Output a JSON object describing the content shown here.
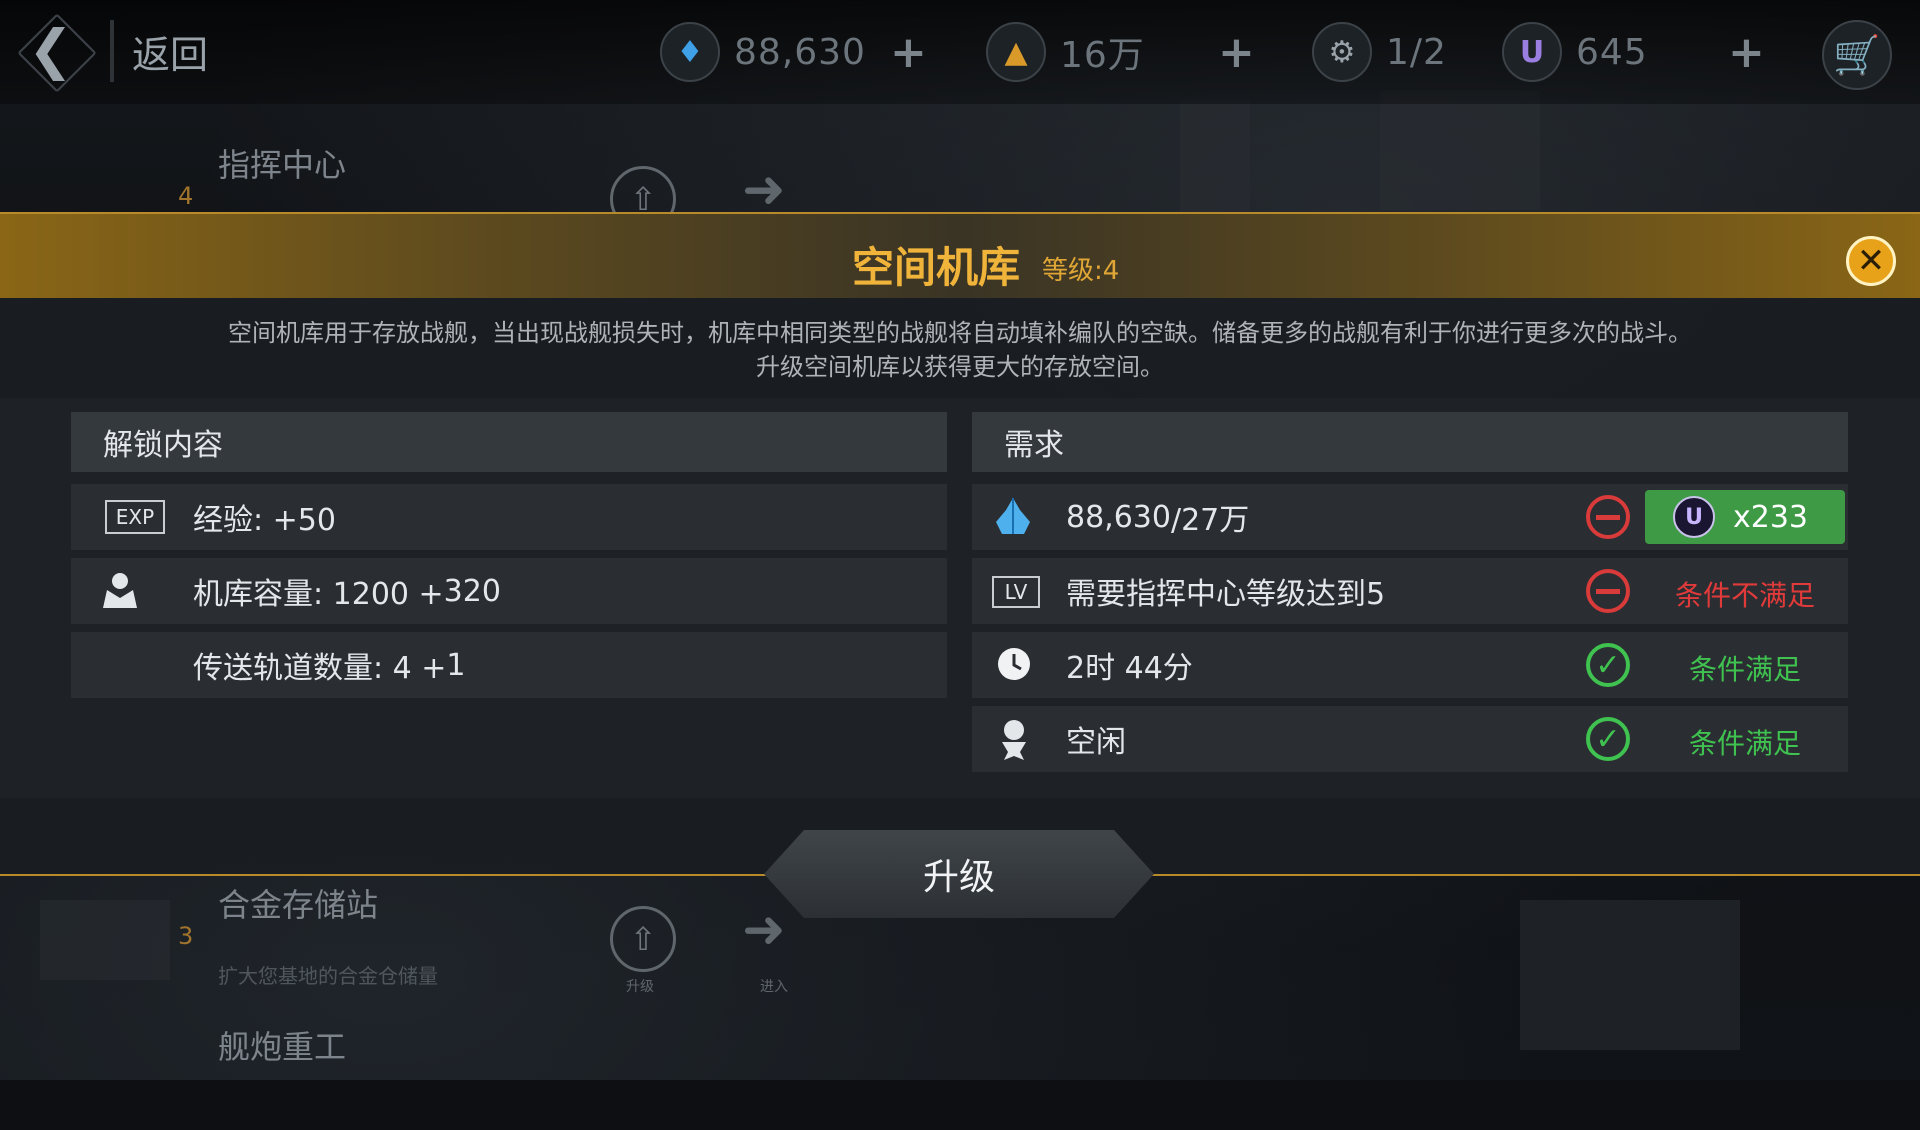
{
  "topbar": {
    "back_label": "返回",
    "resources": [
      {
        "icon": "crystal-icon",
        "value": "88,630"
      },
      {
        "icon": "alloy-icon",
        "value": "16万"
      },
      {
        "icon": "drone-icon",
        "value": "1/2"
      },
      {
        "icon": "u-currency-icon",
        "value": "645"
      }
    ]
  },
  "background_list": [
    {
      "title": "指挥中心",
      "level": "4",
      "subtitle": "",
      "upgrade_caption": "",
      "enter_caption": ""
    },
    {
      "title": "合金存储站",
      "level": "3",
      "subtitle": "扩大您基地的合金仓储量",
      "upgrade_caption": "升级",
      "enter_caption": "进入"
    },
    {
      "title": "舰炮重工",
      "level": "",
      "subtitle": "",
      "upgrade_caption": "",
      "enter_caption": ""
    }
  ],
  "dialog": {
    "title": "空间机库",
    "level_label": "等级:4",
    "description_line1": "空间机库用于存放战舰，当出现战舰损失时，机库中相同类型的战舰将自动填补编队的空缺。储备更多的战舰有利于你进行更多次的战斗。",
    "description_line2": "升级空间机库以获得更大的存放空间。",
    "unlock": {
      "header": "解锁内容",
      "rows": [
        {
          "icon": "exp-badge-icon",
          "icon_text": "EXP",
          "label": "经验: +50",
          "extra": ""
        },
        {
          "icon": "hangar-capacity-icon",
          "icon_text": "",
          "label": "机库容量: 1200 + ",
          "extra": "320"
        },
        {
          "icon": "",
          "icon_text": "",
          "label": "传送轨道数量: 4 + ",
          "extra": "1"
        }
      ]
    },
    "requirements": {
      "header": "需求",
      "rows": [
        {
          "icon": "crystal-icon",
          "current": "88,630",
          "required": "/27万",
          "status": "unmet",
          "action_currency": "U",
          "action_count": "x233"
        },
        {
          "icon": "lv-badge-icon",
          "icon_text": "LV",
          "label": "需要指挥中心等级达到5",
          "status": "unmet",
          "status_text": "条件不满足"
        },
        {
          "icon": "clock-icon",
          "label": "2时 44分",
          "status": "met",
          "status_text": "条件满足"
        },
        {
          "icon": "drone-icon",
          "label": "空闲",
          "status": "met",
          "status_text": "条件满足"
        }
      ]
    },
    "upgrade_button": "升级"
  },
  "colors": {
    "accent_gold": "#f0b43a",
    "unmet_red": "#e13a3a",
    "met_green": "#3fc24f",
    "gem_button": "#3f9a46"
  }
}
